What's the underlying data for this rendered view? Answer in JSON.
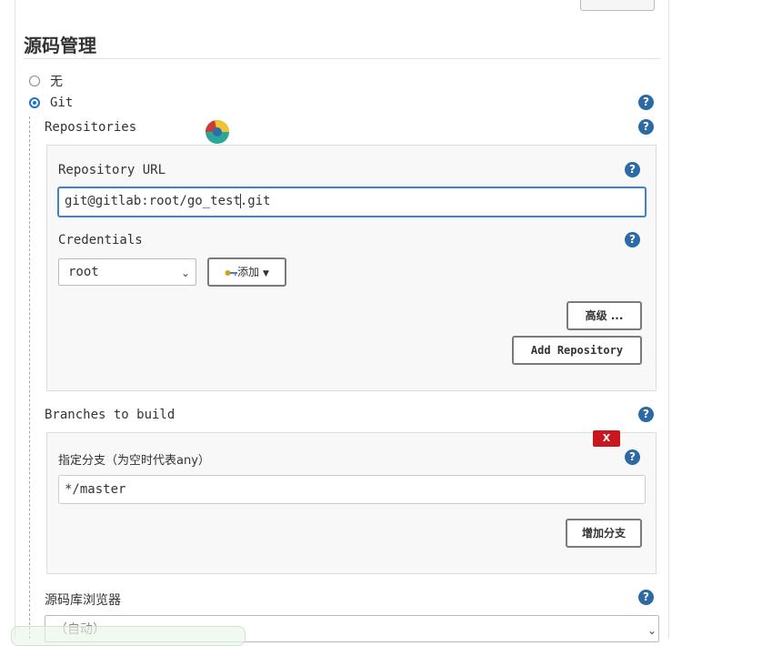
{
  "section": {
    "title": "源码管理"
  },
  "scm_options": [
    {
      "label": "无",
      "selected": false
    },
    {
      "label": "Git",
      "selected": true
    }
  ],
  "repositories": {
    "label": "Repositories",
    "url_label": "Repository URL",
    "url_value_before_caret": "git@gitlab:root/go_test",
    "url_value_after_caret": ".git",
    "credentials_label": "Credentials",
    "credentials_selected": "root",
    "add_button": "添加",
    "advanced_button": "高级 ...",
    "add_repository_button": "Add Repository"
  },
  "branches": {
    "label": "Branches to build",
    "delete_badge": "X",
    "specifier_label": "指定分支（为空时代表any）",
    "specifier_value": "*/master",
    "add_branch_button": "增加分支"
  },
  "browser": {
    "label": "源码库浏览器",
    "selected": "（自动）"
  },
  "help_glyph": "?",
  "colors": {
    "help_icon": "#2b6aa6",
    "focus_border": "#3b82d4",
    "delete_badge": "#c8181e"
  }
}
